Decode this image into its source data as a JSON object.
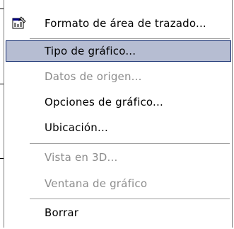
{
  "menu": {
    "items": [
      {
        "label": "Formato de área de trazado...",
        "state": "normal",
        "icon": "format-plot-area-icon"
      },
      {
        "label": "Tipo de gráfico...",
        "state": "selected"
      },
      {
        "label": "Datos de origen...",
        "state": "disabled"
      },
      {
        "label": "Opciones de gráfico...",
        "state": "normal"
      },
      {
        "label": "Ubicación...",
        "state": "normal"
      },
      {
        "label": "Vista en 3D...",
        "state": "disabled"
      },
      {
        "label": "Ventana de gráfico",
        "state": "disabled"
      },
      {
        "label": "Borrar",
        "state": "normal"
      }
    ]
  },
  "colors": {
    "highlight_fill": "#b6bdd2",
    "highlight_border": "#0a246a",
    "disabled_text": "#8c8c8c"
  }
}
